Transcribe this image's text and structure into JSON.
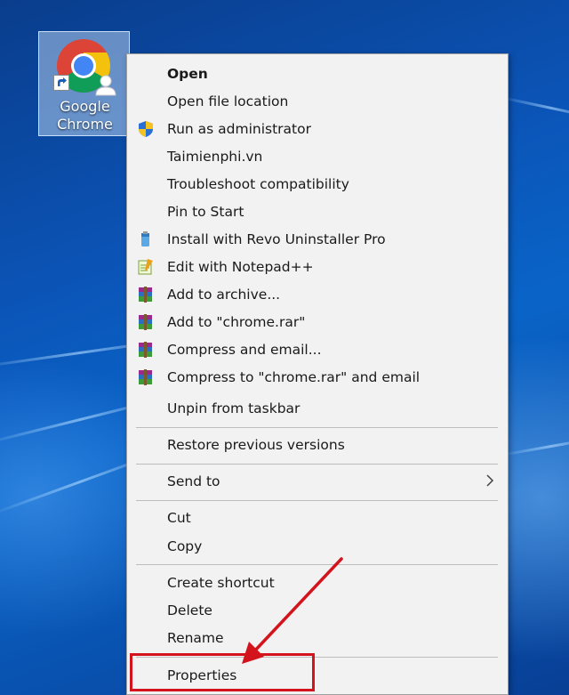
{
  "desktop": {
    "icon_label_line1": "Google",
    "icon_label_line2": "Chrome",
    "icon": "google-chrome-icon"
  },
  "context_menu": {
    "items": [
      {
        "label": "Open",
        "bold": true
      },
      {
        "label": "Open file location"
      },
      {
        "label": "Run as administrator",
        "icon": "uac-shield-icon"
      },
      {
        "label": "Taimienphi.vn"
      },
      {
        "label": "Troubleshoot compatibility"
      },
      {
        "label": "Pin to Start"
      },
      {
        "label": "Install with Revo Uninstaller Pro",
        "icon": "revo-uninstaller-icon"
      },
      {
        "label": "Edit with Notepad++",
        "icon": "notepad-plus-plus-icon"
      },
      {
        "label": "Add to archive...",
        "icon": "winrar-icon"
      },
      {
        "label": "Add to \"chrome.rar\"",
        "icon": "winrar-icon"
      },
      {
        "label": "Compress and email...",
        "icon": "winrar-icon"
      },
      {
        "label": "Compress to \"chrome.rar\" and email",
        "icon": "winrar-icon"
      },
      {
        "label": "Unpin from taskbar"
      },
      {
        "label": "Restore previous versions"
      },
      {
        "label": "Send to",
        "submenu": true
      },
      {
        "label": "Cut"
      },
      {
        "label": "Copy"
      },
      {
        "label": "Create shortcut"
      },
      {
        "label": "Delete"
      },
      {
        "label": "Rename"
      },
      {
        "label": "Properties"
      }
    ]
  },
  "annotation": {
    "highlight_color": "#d3141c",
    "highlighted_item": "Properties"
  }
}
